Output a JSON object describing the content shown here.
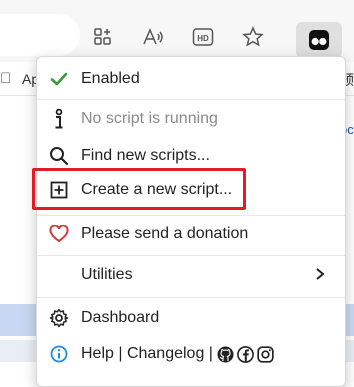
{
  "bookmarks": {
    "left_text": "Ap",
    "right_text": "预"
  },
  "page": {
    "right_link_text": "oc"
  },
  "menu": {
    "items": [
      {
        "label": "Enabled",
        "icon": "check-icon"
      },
      {
        "label": "No script is running",
        "icon": "info-icon"
      },
      {
        "label": "Find new scripts...",
        "icon": "search-icon"
      },
      {
        "label": "Create a new script...",
        "icon": "plus-square-icon"
      },
      {
        "label": "Please send a donation",
        "icon": "heart-icon"
      },
      {
        "label": "Utilities",
        "icon": "chevron-right-icon"
      },
      {
        "label": "Dashboard",
        "icon": "gear-icon"
      },
      {
        "label": "Help | Changelog |",
        "icon": "info-circle-icon"
      }
    ]
  },
  "colors": {
    "check": "#3a9a3a",
    "heart": "#d23a3a",
    "info": "#1f8fd6",
    "highlight": "#e21b24"
  }
}
